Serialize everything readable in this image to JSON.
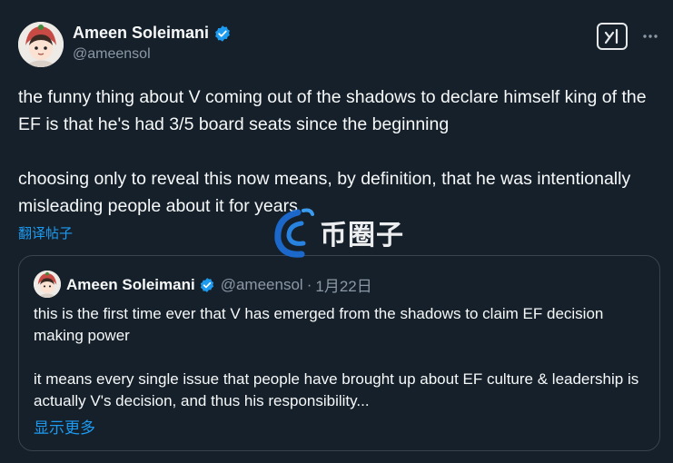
{
  "post": {
    "author": {
      "display_name": "Ameen Soleimani",
      "handle": "@ameensol",
      "verified": true
    },
    "paragraphs": [
      "the funny thing about V coming out of the shadows to declare himself king of the EF is that he's had 3/5 board seats since the beginning",
      "choosing only to reveal this now means, by definition, that he was intentionally misleading people about it for years"
    ],
    "translate_label": "翻译帖子"
  },
  "quote": {
    "author": {
      "display_name": "Ameen Soleimani",
      "handle": "@ameensol",
      "separator": "·",
      "date": "1月22日"
    },
    "paragraphs": [
      "this is the first time ever that V has emerged from the shadows to claim EF decision making power",
      "it means every single issue that people have brought up about EF culture & leadership is actually V's decision, and thus his responsibility..."
    ],
    "show_more_label": "显示更多"
  },
  "watermark": {
    "text": "币圈子"
  },
  "colors": {
    "background": "#15202b",
    "text": "#f7f9f9",
    "muted": "#8b98a5",
    "link": "#1d9bf0",
    "verified": "#1d9bf0",
    "border": "#38444d"
  },
  "icons": {
    "verified": "verified-badge-icon",
    "grok": "grok-icon",
    "more": "more-dots-icon"
  }
}
